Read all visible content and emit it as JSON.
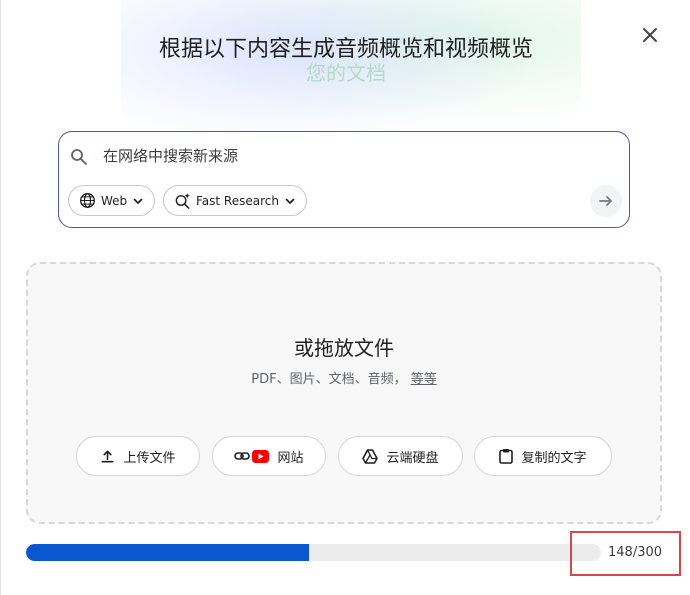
{
  "dialog": {
    "title": "根据以下内容生成音频概览和视频概览",
    "subtitle": "您的文档",
    "close_icon": "close-icon"
  },
  "search": {
    "placeholder": "在网络中搜索新来源",
    "chips": [
      {
        "label": "Web",
        "icon": "globe-icon"
      },
      {
        "label": "Fast Research",
        "icon": "sparkle-search-icon"
      }
    ],
    "submit_icon": "arrow-right-icon"
  },
  "dropzone": {
    "title": "或拖放文件",
    "subtitle": "PDF、图片、文档、音频，",
    "more_link": "等等",
    "buttons": [
      {
        "label": "上传文件",
        "icon": "upload-icon"
      },
      {
        "label": "网站",
        "icon": "link-youtube-icon"
      },
      {
        "label": "云端硬盘",
        "icon": "drive-icon"
      },
      {
        "label": "复制的文字",
        "icon": "clipboard-icon"
      }
    ]
  },
  "source_limit": {
    "used": 148,
    "max": 300,
    "text": "148/300",
    "fill_fraction": 0.493
  },
  "colors": {
    "accent": "#0b57d0",
    "highlight": "#d84848",
    "youtube": "#ff0000"
  }
}
